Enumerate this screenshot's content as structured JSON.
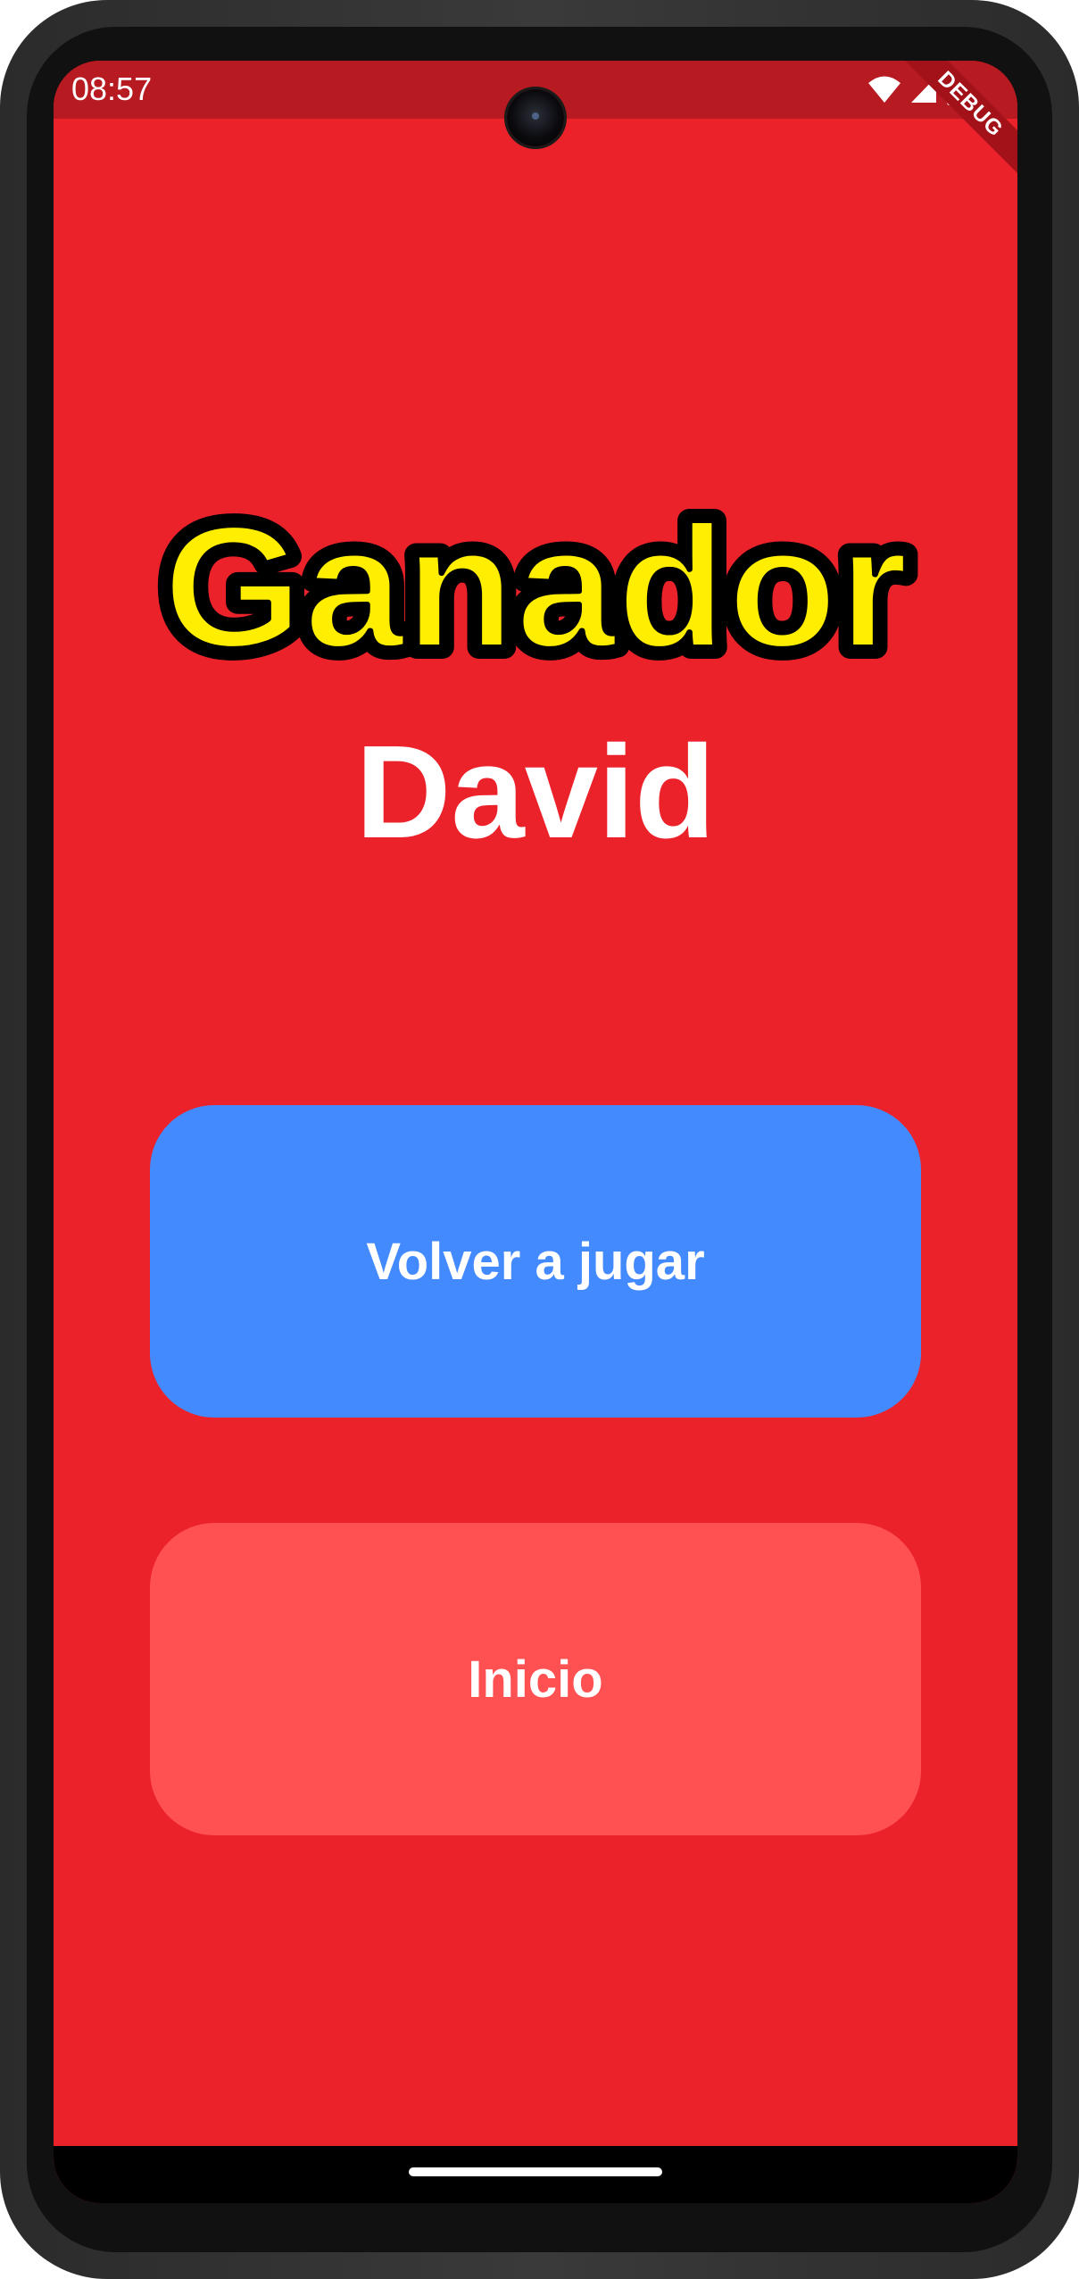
{
  "status_bar": {
    "time": "08:57",
    "icons": [
      "wifi-icon",
      "signal-icon",
      "battery-icon"
    ]
  },
  "debug_banner": "DEBUG",
  "logo": {
    "text": "Ganador"
  },
  "winner": {
    "name": "David"
  },
  "buttons": {
    "play_again": "Volver a jugar",
    "home": "Inicio"
  },
  "colors": {
    "background": "#ec222b",
    "status_bar": "#b71a21",
    "play_again_button": "#448aff",
    "home_button": "#ff5052",
    "logo_fill": "#ffee00",
    "text": "#ffffff"
  }
}
